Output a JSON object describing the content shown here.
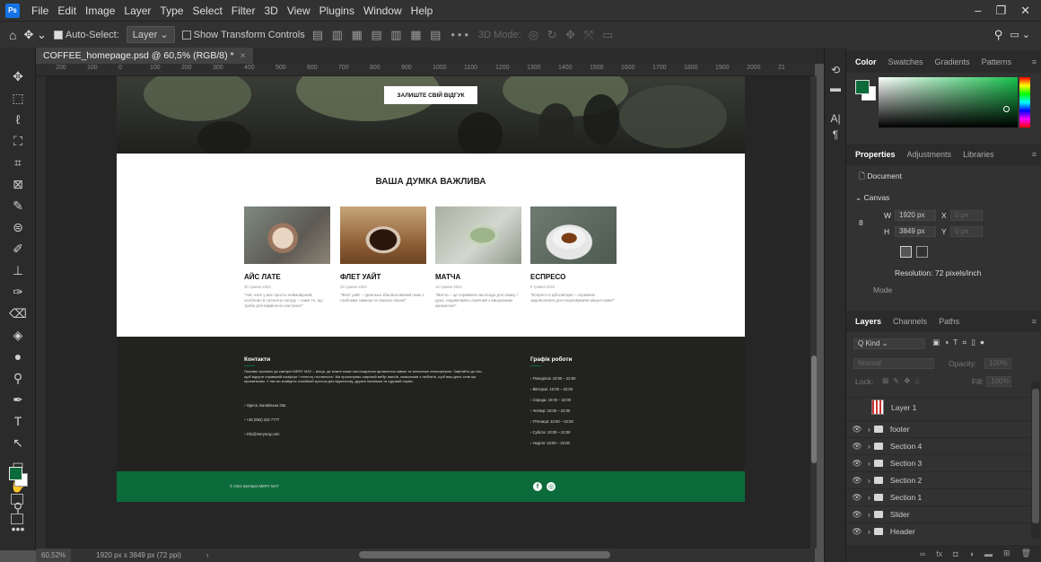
{
  "app": {
    "menu": [
      "File",
      "Edit",
      "Image",
      "Layer",
      "Type",
      "Select",
      "Filter",
      "3D",
      "View",
      "Plugins",
      "Window",
      "Help"
    ],
    "logo": "Ps"
  },
  "options": {
    "auto_select_label": "Auto-Select:",
    "auto_select_value": "Layer",
    "show_transform": "Show Transform Controls",
    "mode_3d": "3D Mode:"
  },
  "doc": {
    "tab_title": "COFFEE_homepage.psd @ 60,5% (RGB/8) *",
    "zoom": "60,52%",
    "size_info": "1920 px x 3849 px (72 ppi)",
    "ruler_top": [
      "200",
      "100",
      "0",
      "100",
      "200",
      "300",
      "400",
      "500",
      "600",
      "700",
      "800",
      "900",
      "1000",
      "1100",
      "1200",
      "1300",
      "1400",
      "1500",
      "1600",
      "1700",
      "1800",
      "1900",
      "2000",
      "21"
    ]
  },
  "site": {
    "hero_button": "ЗАЛИШТЕ СВІЙ ВІДГУК",
    "opinion_title": "ВАША ДУМКА ВАЖЛИВА",
    "cards": [
      {
        "name": "АЙС ЛАТЕ",
        "date": "30 травня 2024",
        "desc": "\"Айс лате у вас просто неймовірний, особливо в спекотну погоду – саме те, що треба для відмінного настрою!\""
      },
      {
        "name": "ФЛЕТ УАЙТ",
        "date": "28 травня 2024",
        "desc": "\"Флет уайт – ідеально збалансований смак з глибоким смаком та ніжною піною!\""
      },
      {
        "name": "МАТЧА",
        "date": "15 травня 2024",
        "desc": "\"Матча – це справжня насолода для смаку і душі, надзвичайно смачний з вишуканим ароматом!\""
      },
      {
        "name": "ЕСПРЕСО",
        "date": "9 травня 2024",
        "desc": "\"Еспресо в цій кав'ярні – справжнє задоволення для поціновувачів міцної кави!\""
      }
    ],
    "contacts_title": "Контакти",
    "contacts_text": "Ласкаво просимо до кав'ярні MERY MAY – місця, де кожен може насолодитися ароматною кавою та затишною атмосферою. Завітайте до нас, щоб відчути справжній комфорт і теплоту гостинності. Ми пропонуємо широкий вибір напоїв, смаколиків з любов'ю, щоб ваш день став ще приємнішим. У нас ви знайдете спокійний куточок для відпочинку, дружні посмішки та чудовий сервіс.",
    "contacts": [
      "Одеса, Балківська 33а",
      "+38 (093) 333 7777",
      "info@merymay.com"
    ],
    "hours_title": "Графік роботи",
    "hours": [
      "Понеділок: 10:00 – 22:00",
      "Вівторок: 10:00 – 22:00",
      "Середа: 10:00 – 22:00",
      "Четвер: 10:00 – 22:00",
      "П'ятниця: 10:00 – 22:00",
      "Субота: 10:00 – 22:00",
      "Неділя: 10:00 – 22:00"
    ],
    "copyright": "© 2024 Кав'ярня MERY MAY",
    "social": [
      "f",
      "◎"
    ]
  },
  "panels": {
    "color_tabs": [
      "Color",
      "Swatches",
      "Gradients",
      "Patterns"
    ],
    "prop_tabs": [
      "Properties",
      "Adjustments",
      "Libraries"
    ],
    "document_label": "Document",
    "canvas_label": "Canvas",
    "w_label": "W",
    "w_value": "1920 px",
    "h_label": "H",
    "h_value": "3849 px",
    "x_label": "X",
    "x_value": "0 px",
    "y_label": "Y",
    "y_value": "0 px",
    "resolution": "Resolution: 72 pixels/inch",
    "mode_label": "Mode",
    "layer_tabs": [
      "Layers",
      "Channels",
      "Paths"
    ],
    "kind_label": "Q Kind",
    "blend_mode": "Normal",
    "opacity_label": "Opacity:",
    "opacity_value": "100%",
    "lock_label": "Lock:",
    "fill_label": "Fill:",
    "fill_value": "100%",
    "layers": [
      "Layer 1",
      "footer",
      "Section 4",
      "Section 3",
      "Section 2",
      "Section 1",
      "Slider",
      "Header"
    ]
  },
  "colors": {
    "accent_green": "#0b6b3a",
    "foreground": "#0b6b3a"
  }
}
